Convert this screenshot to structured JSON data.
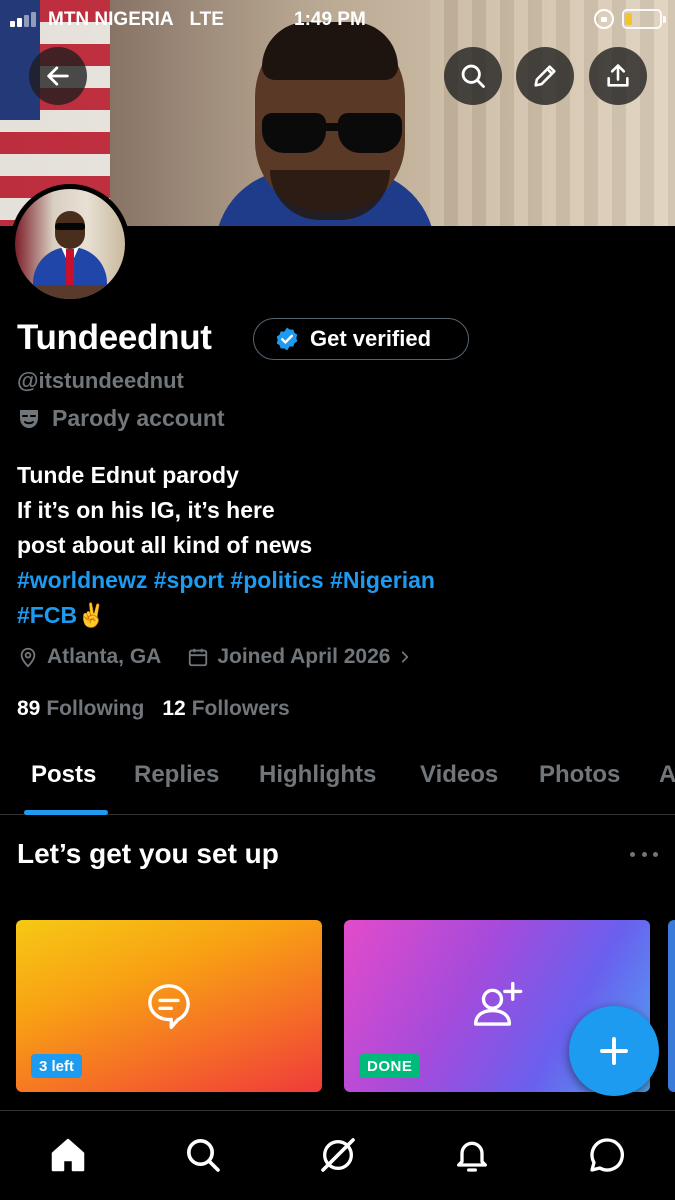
{
  "status_bar": {
    "carrier": "MTN NIGERIA",
    "network": "LTE",
    "time": "1:49 PM"
  },
  "header": {
    "back_icon": "arrow-left-icon",
    "search_icon": "search-icon",
    "edit_icon": "pencil-icon",
    "share_icon": "share-icon"
  },
  "profile": {
    "name": "Tundeednut",
    "verify_label": "Get verified",
    "handle": "@itstundeednut",
    "parody_label": "Parody account",
    "bio_lines": [
      "Tunde Ednut parody",
      "If it’s on his IG, it’s here",
      "post about all kind of news"
    ],
    "bio_tags_line1": "#worldnewz #sport #politics #Nigerian",
    "bio_tags_line2": "#FCB",
    "bio_emoji": "✌️",
    "location": "Atlanta, GA",
    "joined": "Joined April 2026",
    "following_count": "89",
    "following_label": "Following",
    "followers_count": "12",
    "followers_label": "Followers"
  },
  "tabs": [
    "Posts",
    "Replies",
    "Highlights",
    "Videos",
    "Photos",
    "A"
  ],
  "active_tab": "Posts",
  "setup": {
    "title": "Let’s get you set up",
    "cards": [
      {
        "icon": "speech-bubble-icon",
        "badge": "3 left"
      },
      {
        "icon": "add-person-icon",
        "badge": "DONE"
      }
    ]
  },
  "fab_icon": "plus-icon",
  "bottom_nav": [
    "home-icon",
    "search-icon",
    "grok-icon",
    "bell-icon",
    "messages-icon"
  ],
  "colors": {
    "accent": "#1d9bf0",
    "done_green": "#00ba7c",
    "muted": "#71767b",
    "background": "#000000"
  }
}
